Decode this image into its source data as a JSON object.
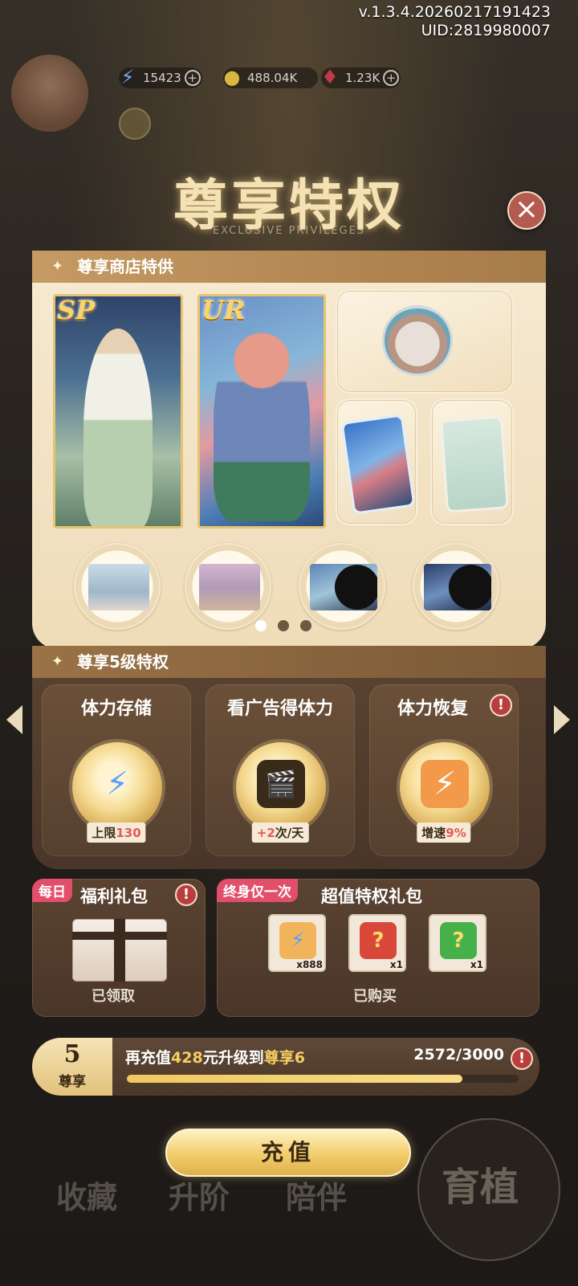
{
  "header": {
    "version": "v.1.3.4.20260217191423",
    "uid": "UID:2819980007"
  },
  "resources": [
    {
      "icon": "energy-icon",
      "value": "15423"
    },
    {
      "icon": "coin-icon",
      "value": "488.04K"
    },
    {
      "icon": "gem-icon",
      "value": "1.23K"
    }
  ],
  "modal": {
    "title": "尊享特权",
    "subtitle": "EXCLUSIVE PRIVILEGES",
    "close_label": "×"
  },
  "shop": {
    "title": "尊享商店特供",
    "cards": [
      {
        "rarity": "SP"
      },
      {
        "rarity": "UR"
      }
    ],
    "page_count": 3,
    "active_page": 0
  },
  "privilege": {
    "title": "尊享5级特权",
    "items": [
      {
        "title": "体力存储",
        "value_prefix": "上限",
        "value_highlight": "130",
        "value_suffix": ""
      },
      {
        "title": "看广告得体力",
        "value_prefix": "",
        "value_highlight": "+2",
        "value_suffix": "次/天"
      },
      {
        "title": "体力恢复",
        "value_prefix": "增速",
        "value_highlight": "9%",
        "value_suffix": ""
      }
    ],
    "warn": "!"
  },
  "daily_gift": {
    "tag": "每日",
    "title": "福利礼包",
    "status": "已领取",
    "warn": "!"
  },
  "lifetime_gift": {
    "tag": "终身仅一次",
    "title": "超值特权礼包",
    "status": "已购买",
    "items": [
      {
        "name": "energy",
        "qty": "x888"
      },
      {
        "name": "red-dice",
        "qty": "x1"
      },
      {
        "name": "green-dice",
        "qty": "x1"
      }
    ]
  },
  "progress": {
    "level": "5",
    "level_label": "尊享",
    "text_prefix": "再充值",
    "amount": "428",
    "text_mid": "元升级到",
    "target": "尊享6",
    "current": 2572,
    "total": 3000,
    "display": "2572/3000",
    "warn": "!"
  },
  "recharge_label": "充值",
  "bottom_nav": [
    "收藏",
    "升阶",
    "陪伴"
  ],
  "corner_label": "育植"
}
